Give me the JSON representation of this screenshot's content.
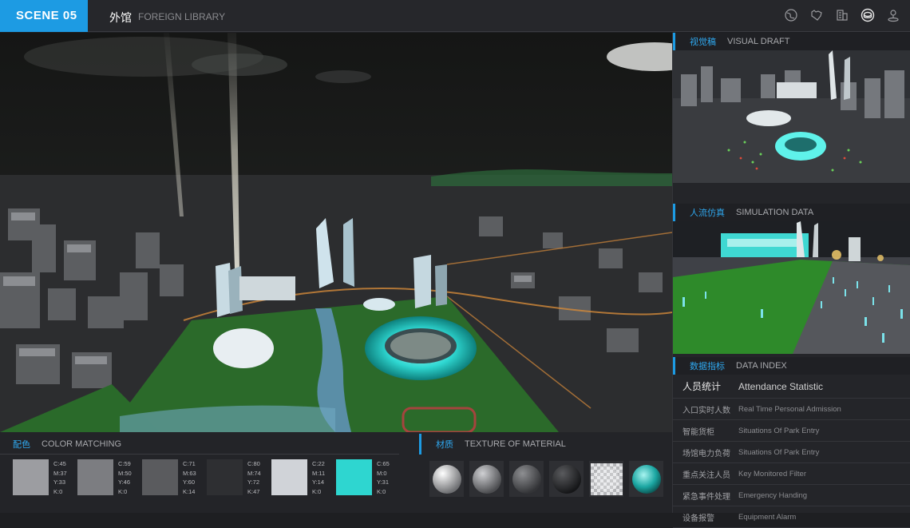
{
  "header": {
    "scene_label": "SCENE 05",
    "title_cn": "外馆",
    "title_en": "FOREIGN LIBRARY",
    "icons": [
      "globe-icon",
      "heart-map-icon",
      "building-icon",
      "stadium-icon",
      "person-pin-icon"
    ],
    "accent": "#1d9be3"
  },
  "visual_draft": {
    "cn": "视觉稿",
    "en": "VISUAL DRAFT"
  },
  "simulation": {
    "cn": "人流仿真",
    "en": "SIMULATION DATA"
  },
  "data_index": {
    "cn": "数据指标",
    "en": "DATA INDEX",
    "header_row": {
      "cn": "人员统计",
      "en": "Attendance Statistic"
    },
    "rows": [
      {
        "cn": "入口实时人数",
        "en": "Real Time Personal Admission"
      },
      {
        "cn": "智能货柜",
        "en": "Situations Of Park Entry"
      },
      {
        "cn": "场馆电力负荷",
        "en": "Situations Of Park Entry"
      },
      {
        "cn": "重点关注人员",
        "en": "Key Monitored Filter"
      },
      {
        "cn": "紧急事件处理",
        "en": "Emergency Handing"
      },
      {
        "cn": "设备报警",
        "en": "Equipment Alarm"
      }
    ]
  },
  "color_matching": {
    "cn": "配色",
    "en": "COLOR MATCHING",
    "swatches": [
      {
        "hex": "#9c9da1",
        "c": "C:45",
        "m": "M:37",
        "y": "Y:33",
        "k": "K:0"
      },
      {
        "hex": "#7c7d81",
        "c": "C:59",
        "m": "M:50",
        "y": "Y:46",
        "k": "K:0"
      },
      {
        "hex": "#5a5b5e",
        "c": "C:71",
        "m": "M:63",
        "y": "Y:60",
        "k": "K:14"
      },
      {
        "hex": "#2e2f32",
        "c": "C:80",
        "m": "M:74",
        "y": "Y:72",
        "k": "K:47"
      },
      {
        "hex": "#d0d3d8",
        "c": "C:22",
        "m": "M:11",
        "y": "Y:14",
        "k": "K:0"
      },
      {
        "hex": "#2ed6d0",
        "c": "C:65",
        "m": "M:0",
        "y": "Y:31",
        "k": "K:0"
      }
    ]
  },
  "texture": {
    "cn": "材质",
    "en": "TEXTURE OF MATERIAL",
    "materials": [
      "white-sphere-icon",
      "grey-sphere-icon",
      "dark-grey-sphere-icon",
      "black-sphere-icon",
      "transparent-sphere-icon",
      "teal-glass-sphere-icon"
    ]
  }
}
